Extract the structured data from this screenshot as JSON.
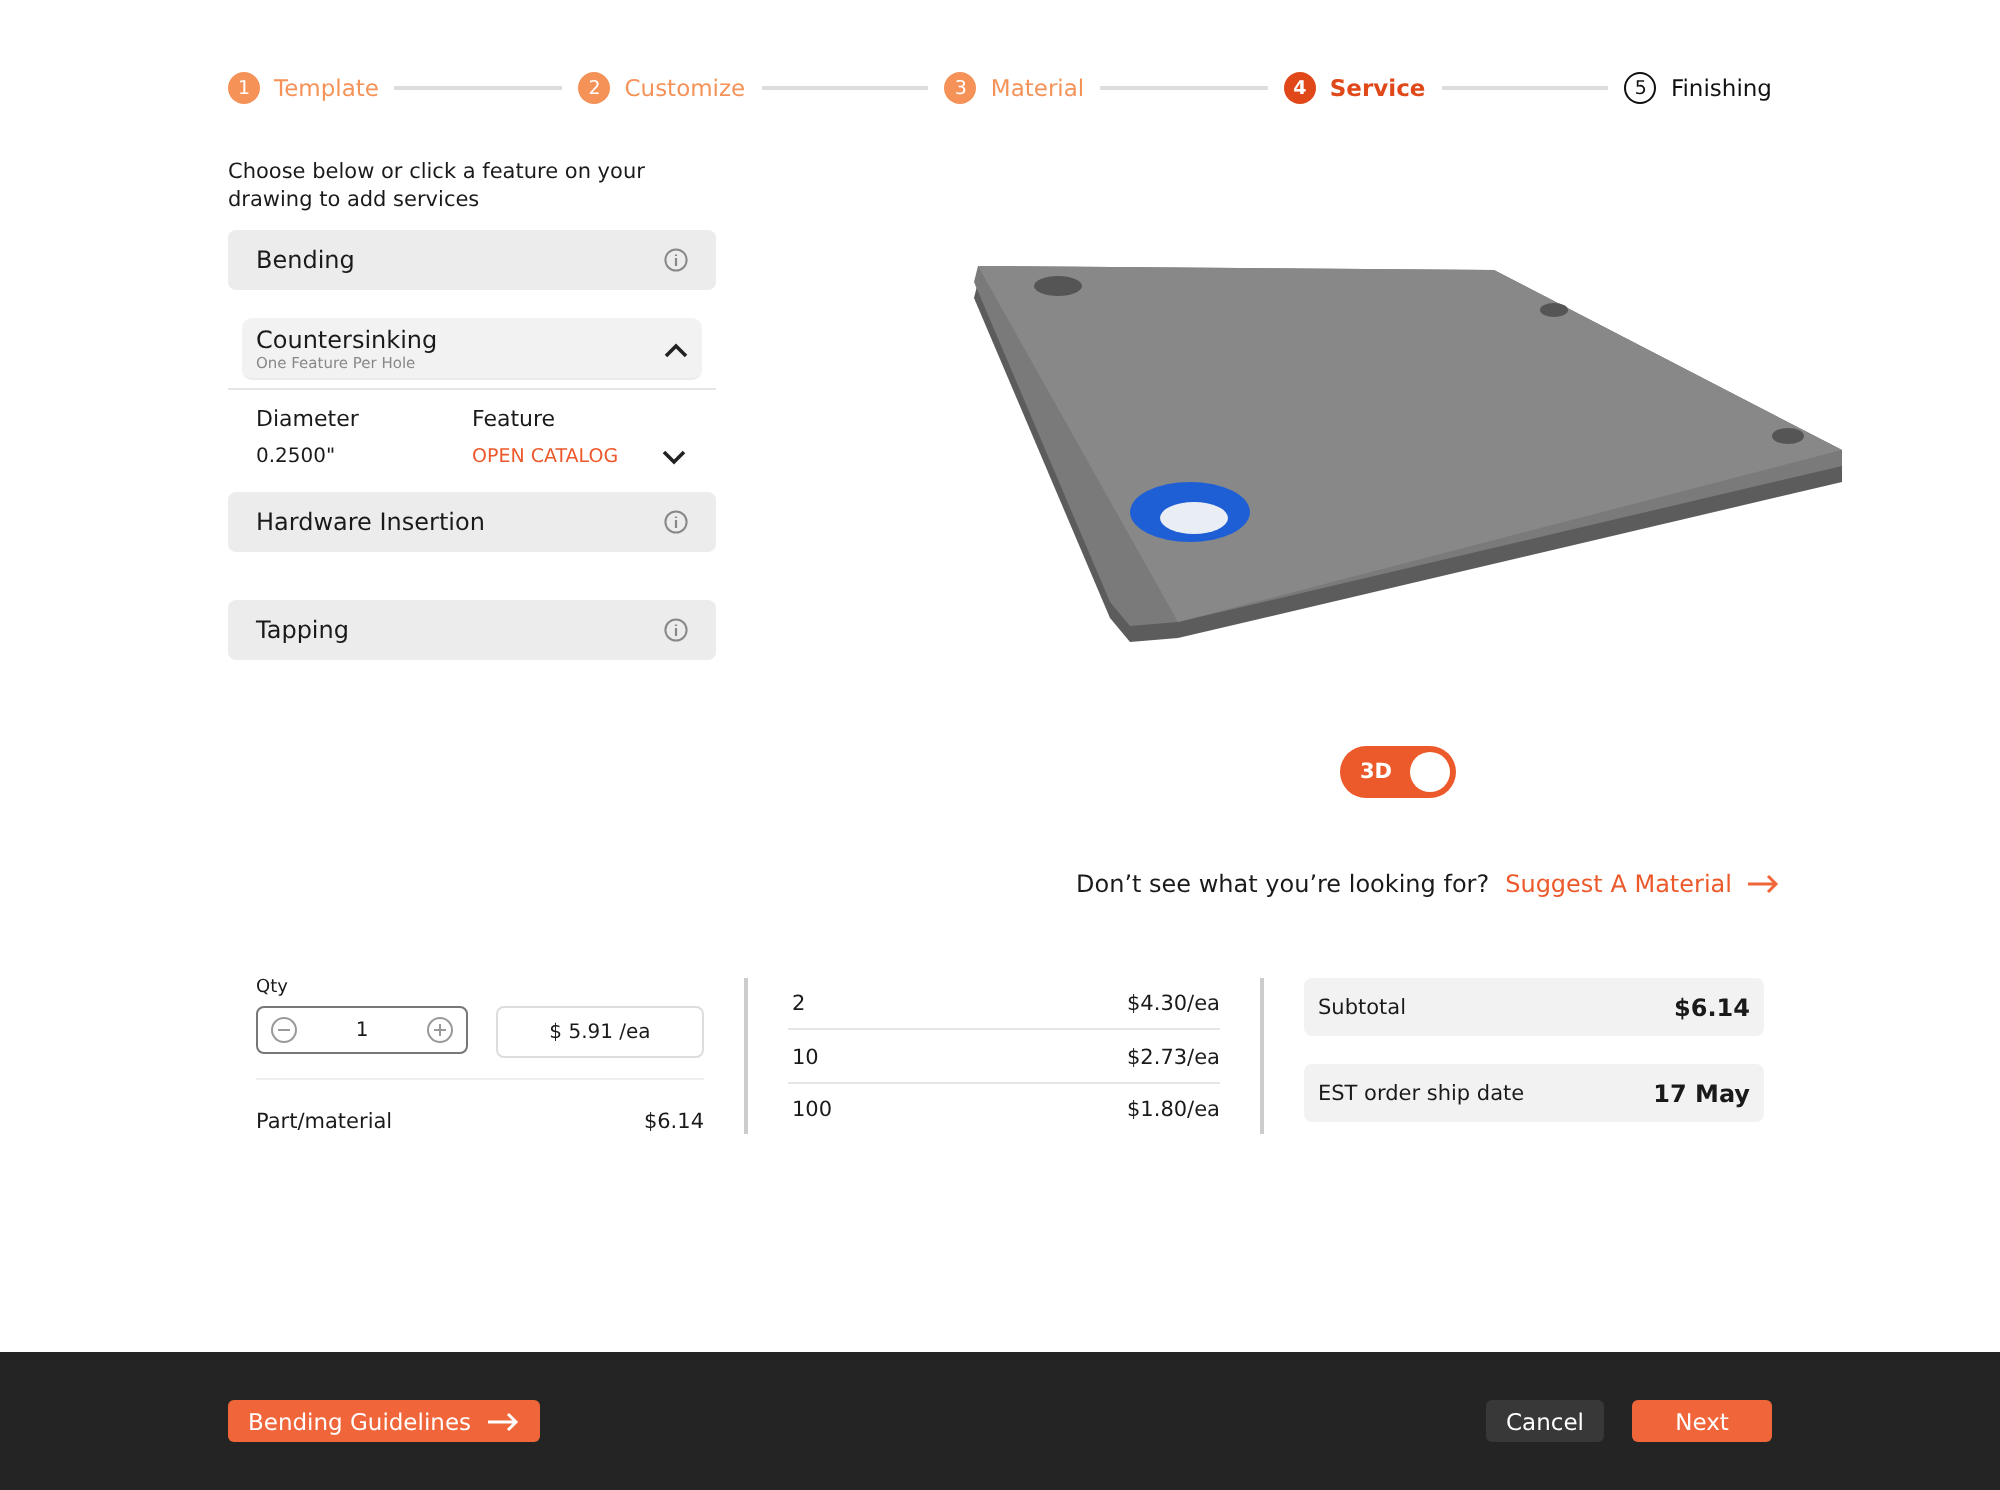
{
  "steps": [
    {
      "number": "1",
      "label": "Template",
      "selected": false
    },
    {
      "number": "2",
      "label": "Customize",
      "selected": false
    },
    {
      "number": "3",
      "label": "Material",
      "selected": false
    },
    {
      "number": "4",
      "label": "Service",
      "selected": true
    },
    {
      "number": "5",
      "label": "Finishing",
      "selected": false
    }
  ],
  "instructions": "Choose below or click a feature on your drawing to add services",
  "services": [
    {
      "name": "Bending",
      "expanded": false
    },
    {
      "name": "Countersinking",
      "subtitle": "One Feature Per Hole",
      "expanded": true,
      "columns": [
        "Diameter",
        "Feature"
      ],
      "diameter": "0.2500\"",
      "feature_link": "OPEN CATALOG"
    },
    {
      "name": "Hardware Insertion",
      "expanded": false
    },
    {
      "name": "Tapping",
      "expanded": false
    }
  ],
  "view_toggle": {
    "label": "3D",
    "on": true
  },
  "suggest": {
    "question": "Don’t see what you’re looking for?",
    "link": "Suggest A Material"
  },
  "quantity": {
    "label": "Qty",
    "value": "1",
    "unit_price": "$ 5.91 /ea"
  },
  "part_material": {
    "label": "Part/material",
    "value": "$6.14"
  },
  "price_breaks": [
    {
      "qty": "2",
      "price": "$4.30/ea"
    },
    {
      "qty": "10",
      "price": "$2.73/ea"
    },
    {
      "qty": "100",
      "price": "$1.80/ea"
    }
  ],
  "summary": [
    {
      "label": "Subtotal",
      "value": "$6.14"
    },
    {
      "label": "EST order ship date",
      "value": "17 May"
    }
  ],
  "footer": {
    "guidelines": "Bending Guidelines",
    "cancel": "Cancel",
    "next": "Next"
  }
}
